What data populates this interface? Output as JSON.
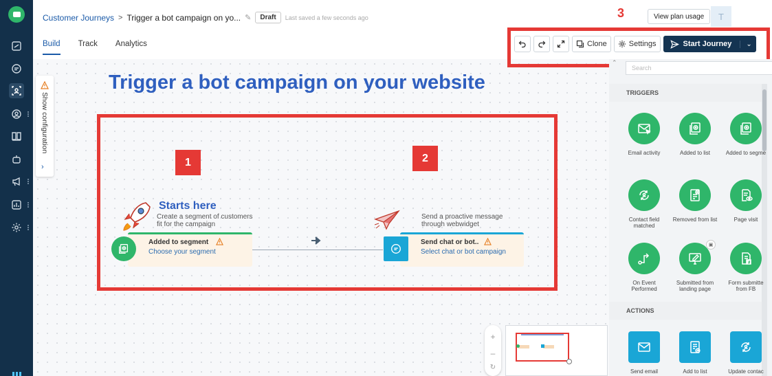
{
  "breadcrumb": {
    "root": "Customer Journeys",
    "separator": ">",
    "current": "Trigger a bot campaign on yo...",
    "status_badge": "Draft",
    "saved_text": "Last saved a few seconds ago"
  },
  "header": {
    "view_plan_label": "View plan usage",
    "avatar_initial": "T"
  },
  "tabs": [
    {
      "label": "Build",
      "active": true
    },
    {
      "label": "Track",
      "active": false
    },
    {
      "label": "Analytics",
      "active": false
    }
  ],
  "toolbar": {
    "undo_icon": "undo-icon",
    "redo_icon": "redo-icon",
    "expand_icon": "expand-icon",
    "clone_label": "Clone",
    "settings_label": "Settings",
    "start_label": "Start Journey"
  },
  "config_strip": {
    "label": "Show configuration"
  },
  "canvas": {
    "title": "Trigger a bot campaign on your website",
    "starts_title": "Starts here",
    "starts_desc": "Create a segment of customers fit for the campaign",
    "node1": {
      "title": "Added to segment",
      "subtitle": "Choose your segment"
    },
    "plane_desc": "Send a proactive message through webwidget",
    "node2": {
      "title": "Send chat or bot..",
      "subtitle": "Select chat or bot campaign"
    }
  },
  "annotations": {
    "box1": "1",
    "box2": "2",
    "box3": "3"
  },
  "zoom": {
    "plus": "+",
    "minus": "–"
  },
  "panel": {
    "search_placeholder": "Search",
    "triggers_header": "TRIGGERS",
    "actions_header": "ACTIONS",
    "triggers": [
      {
        "label": "Email activity",
        "icon": "envelope-cursor-icon"
      },
      {
        "label": "Added to list",
        "icon": "list-add-icon"
      },
      {
        "label": "Added to segme",
        "icon": "segment-add-icon"
      },
      {
        "label": "Contact field\nmatched",
        "icon": "refresh-person-icon"
      },
      {
        "label": "Removed from list",
        "icon": "list-remove-icon"
      },
      {
        "label": "Page visit",
        "icon": "page-eye-icon"
      },
      {
        "label": "On Event\nPerformed",
        "icon": "event-arrow-icon"
      },
      {
        "label": "Submitted from\nlanding page",
        "icon": "monitor-edit-icon"
      },
      {
        "label": "Form submitte\nfrom FB",
        "icon": "form-fb-icon"
      }
    ],
    "actions": [
      {
        "label": "Send email",
        "icon": "envelope-icon"
      },
      {
        "label": "Add to list",
        "icon": "list-add-icon"
      },
      {
        "label": "Update contac",
        "icon": "refresh-person-icon"
      }
    ]
  },
  "colors": {
    "sidebar": "#13304a",
    "brand_green": "#2fb66a",
    "action_blue": "#1aa6d6",
    "annotation_red": "#e53935",
    "title_blue": "#2f5fbf"
  }
}
